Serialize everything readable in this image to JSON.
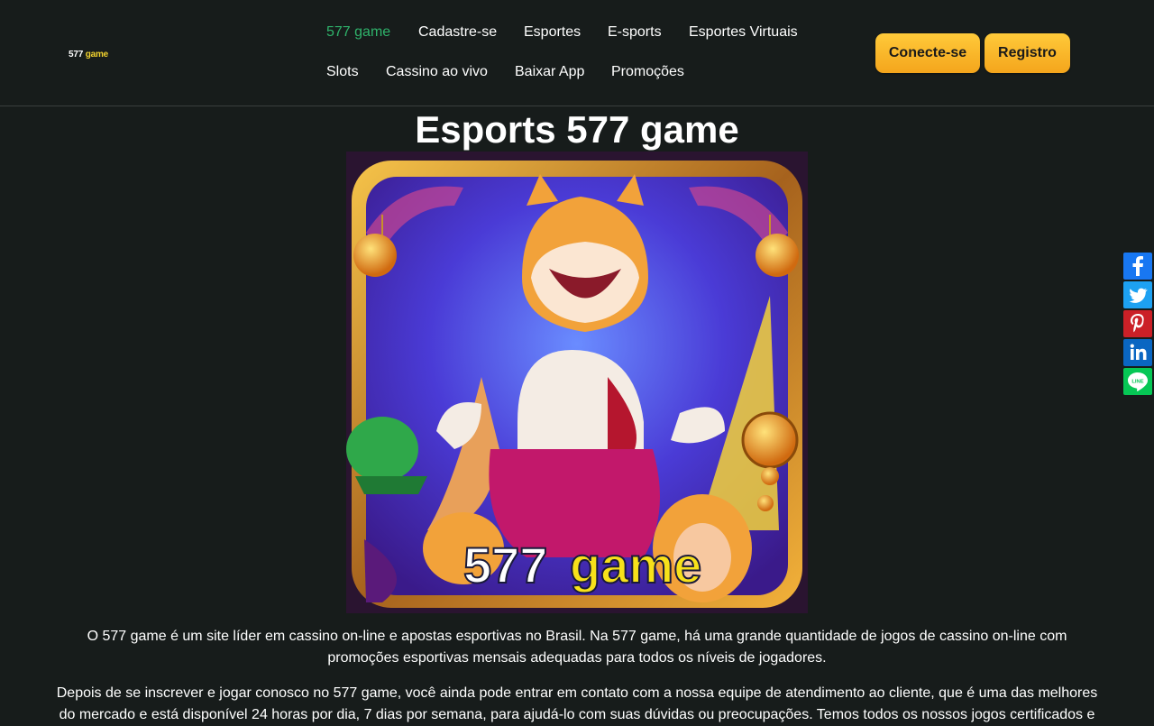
{
  "logo": {
    "part1": "577",
    "part2": "game"
  },
  "nav": {
    "items": [
      {
        "label": "577 game"
      },
      {
        "label": "Cadastre-se"
      },
      {
        "label": "Esportes"
      },
      {
        "label": "E-sports"
      },
      {
        "label": "Esportes Virtuais"
      },
      {
        "label": "Slots"
      },
      {
        "label": "Cassino ao vivo"
      },
      {
        "label": "Baixar App"
      },
      {
        "label": "Promoções"
      }
    ]
  },
  "buttons": {
    "login": "Conecte-se",
    "register": "Registro"
  },
  "main": {
    "title": "Esports 577 game",
    "hero_text_a": "577",
    "hero_text_b": "game",
    "paragraph1": "O 577 game é um site líder em cassino on-line e apostas esportivas no Brasil. Na 577 game, há uma grande quantidade de jogos de cassino on-line com promoções esportivas mensais adequadas para todos os níveis de jogadores.",
    "paragraph2": "Depois de se inscrever e jogar conosco no 577 game, você ainda pode entrar em contato com a nossa equipe de atendimento ao cliente, que é uma das melhores do mercado e está disponível 24 horas por dia, 7 dias por semana, para ajudá-lo com suas dúvidas ou preocupações. Temos todos os nossos jogos certificados e"
  },
  "share": [
    {
      "icon": "facebook-icon",
      "color": "#1877f2",
      "glyph": "f"
    },
    {
      "icon": "twitter-icon",
      "color": "#1da1f2",
      "glyph": "t"
    },
    {
      "icon": "pinterest-icon",
      "color": "#cb2027",
      "glyph": "P"
    },
    {
      "icon": "linkedin-icon",
      "color": "#0a66c2",
      "glyph": "in"
    },
    {
      "icon": "line-icon",
      "color": "#06c755",
      "glyph": "LINE"
    }
  ],
  "colors": {
    "background": "#171c1b",
    "active_nav": "#2fb36b",
    "button": "#f4a51c"
  }
}
